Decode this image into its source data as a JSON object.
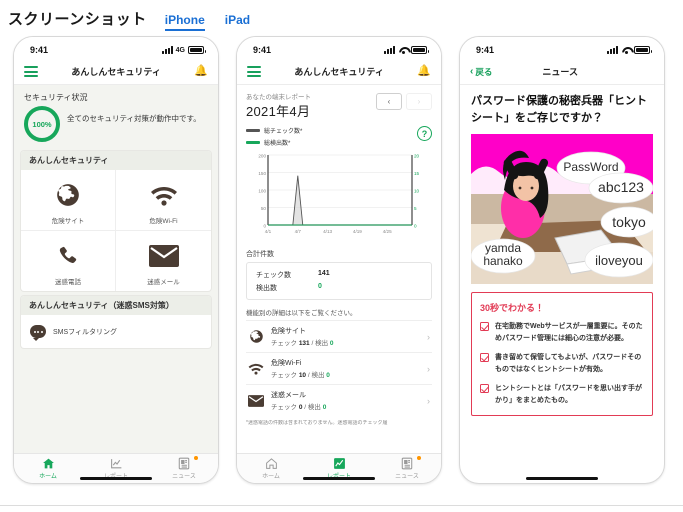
{
  "header": {
    "title": "スクリーンショット",
    "tabs": [
      {
        "label": "iPhone",
        "active": true
      },
      {
        "label": "iPad",
        "active": false
      }
    ]
  },
  "colors": {
    "accent_green": "#17a75b",
    "link_blue": "#1a6fd4",
    "tip_red": "#e23b55",
    "badge_orange": "#ff9500",
    "icon_brown": "#4a3c33",
    "chart_gray": "#555555",
    "chart_green": "#17a75b"
  },
  "screen1": {
    "statusbar": {
      "time": "9:41",
      "network": "4G"
    },
    "navbar": {
      "title": "あんしんセキュリティ",
      "menu_icon": "hamburger-icon",
      "bell_icon": "bell-icon"
    },
    "status_section": {
      "title": "セキュリティ状況",
      "score": "100%",
      "message": "全てのセキュリティ対策が動作中です。"
    },
    "card1": {
      "header": "あんしんセキュリティ",
      "items": [
        {
          "icon": "globe-icon",
          "label": "危険サイト"
        },
        {
          "icon": "wifi-icon",
          "label": "危険Wi-Fi"
        },
        {
          "icon": "phone-icon",
          "label": "迷惑電話"
        },
        {
          "icon": "mail-icon",
          "label": "迷惑メール"
        }
      ]
    },
    "card2": {
      "header": "あんしんセキュリティ（迷惑SMS対策）",
      "items": [
        {
          "icon": "sms-bubble-icon",
          "label": "SMSフィルタリング"
        }
      ]
    },
    "tabbar": [
      {
        "icon": "home-icon",
        "label": "ホーム",
        "active": true,
        "badge": false
      },
      {
        "icon": "report-chart-icon",
        "label": "レポート",
        "active": false,
        "badge": false
      },
      {
        "icon": "news-icon",
        "label": "ニュース",
        "active": false,
        "badge": true
      }
    ]
  },
  "screen2": {
    "statusbar": {
      "time": "9:41",
      "network": "wifi"
    },
    "navbar": {
      "title": "あんしんセキュリティ",
      "menu_icon": "hamburger-icon",
      "bell_icon": "bell-icon"
    },
    "report": {
      "subtitle": "あなたの端末レポート",
      "month": "2021年4月",
      "prev_label": "‹",
      "next_label": "›",
      "help_label": "?"
    },
    "totals": {
      "title": "合計件数",
      "rows": [
        {
          "label": "チェック数",
          "value": "141",
          "green": false
        },
        {
          "label": "検出数",
          "value": "0",
          "green": true
        }
      ]
    },
    "detail_note": "機能別の詳細は以下をご覧ください。",
    "details": [
      {
        "icon": "globe-icon",
        "name": "危険サイト",
        "check_label": "チェック",
        "check": "131",
        "sep": "/",
        "detect_label": "検出",
        "detect": "0"
      },
      {
        "icon": "wifi-icon",
        "name": "危険Wi-Fi",
        "check_label": "チェック",
        "check": "10",
        "sep": "/",
        "detect_label": "検出",
        "detect": "0"
      },
      {
        "icon": "mail-icon",
        "name": "迷惑メール",
        "check_label": "チェック",
        "check": "0",
        "sep": "/",
        "detect_label": "検出",
        "detect": "0"
      }
    ],
    "footnote": "*迷惑電話の件数は含まれておりません。迷惑電話のチェック履",
    "tabbar": [
      {
        "icon": "home-icon",
        "label": "ホーム",
        "active": false,
        "badge": false
      },
      {
        "icon": "report-chart-icon",
        "label": "レポート",
        "active": true,
        "badge": false
      },
      {
        "icon": "news-icon",
        "label": "ニュース",
        "active": false,
        "badge": true
      }
    ]
  },
  "chart_data": {
    "type": "line",
    "title": "あなたの端末レポート 2021年4月",
    "xlabel": "",
    "ylabel": "総チェック数*",
    "y2label": "総検出数*",
    "x": [
      "4/1",
      "4/2",
      "4/3",
      "4/4",
      "4/5",
      "4/6",
      "4/7",
      "4/8",
      "4/9",
      "4/10",
      "4/11",
      "4/12",
      "4/13",
      "4/14",
      "4/15",
      "4/16",
      "4/17",
      "4/18",
      "4/19",
      "4/20",
      "4/21",
      "4/22",
      "4/23",
      "4/24",
      "4/25",
      "4/26",
      "4/27",
      "4/28",
      "4/29",
      "4/30"
    ],
    "tick_labels": [
      "4/1",
      "4/7",
      "4/13",
      "4/19",
      "4/25"
    ],
    "ylim": [
      0,
      200
    ],
    "yticks": [
      0,
      50,
      100,
      150,
      200
    ],
    "y2lim": [
      0,
      20
    ],
    "y2ticks": [
      0,
      5,
      10,
      15,
      20
    ],
    "grid": true,
    "legend_position": "top-left",
    "series": [
      {
        "name": "総チェック数*",
        "color": "#555555",
        "axis": "left",
        "values": [
          0,
          0,
          0,
          0,
          0,
          0,
          141,
          0,
          0,
          0,
          0,
          0,
          0,
          0,
          0,
          0,
          0,
          0,
          0,
          0,
          0,
          0,
          0,
          0,
          0,
          0,
          0,
          0,
          0,
          0
        ]
      },
      {
        "name": "総検出数*",
        "color": "#17a75b",
        "axis": "right",
        "values": [
          0,
          0,
          0,
          0,
          0,
          0,
          0,
          0,
          0,
          0,
          0,
          0,
          0,
          0,
          0,
          0,
          0,
          0,
          0,
          0,
          0,
          0,
          0,
          0,
          0,
          0,
          0,
          0,
          0,
          0
        ]
      }
    ]
  },
  "screen3": {
    "statusbar": {
      "time": "9:41",
      "network": "wifi"
    },
    "navbar": {
      "back_label": "戻る",
      "title": "ニュース"
    },
    "article": {
      "title": "パスワード保護の秘密兵器「ヒントシート」をご存じですか？",
      "hero_alt": "password-illustration",
      "hero_bubbles": [
        "PassWord",
        "abc123",
        "tokyo",
        "yamda hanako",
        "iloveyou"
      ]
    },
    "tips": {
      "title": "30秒でわかる！",
      "items": [
        "在宅勤務でWebサービスが一層重要に。そのためパスワード管理には細心の注意が必要。",
        "書き留めて保管してもよいが、パスワードそのものではなくヒントシートが有効。",
        "ヒントシートとは「パスワードを思い出す手がかり」をまとめたもの。"
      ]
    }
  }
}
